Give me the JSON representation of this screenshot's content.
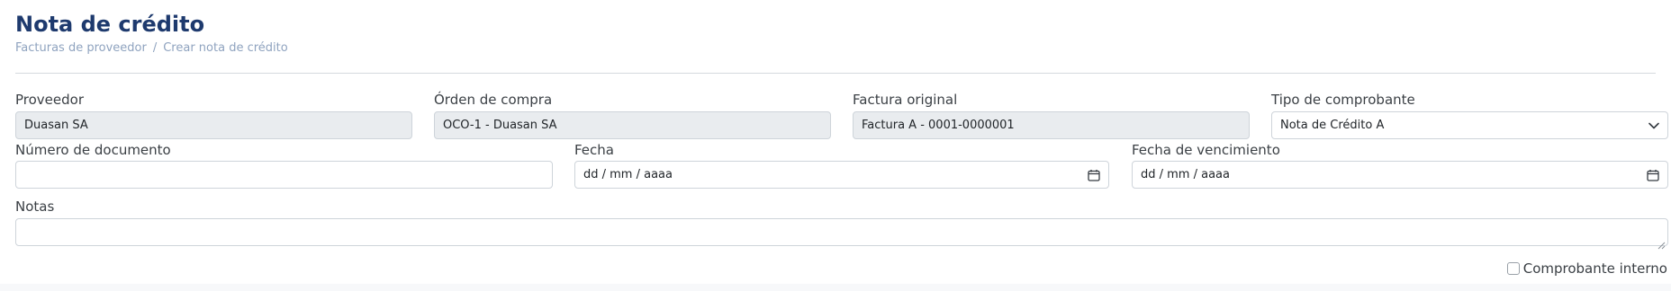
{
  "page": {
    "title": "Nota de crédito",
    "breadcrumb": [
      "Facturas de proveedor",
      "Crear nota de crédito"
    ],
    "breadcrumb_separator": "/"
  },
  "form": {
    "proveedor": {
      "label": "Proveedor",
      "value": "Duasan SA"
    },
    "orden_compra": {
      "label": "Órden de compra",
      "value": "OCO-1 - Duasan SA"
    },
    "factura_original": {
      "label": "Factura original",
      "value": "Factura A - 0001-0000001"
    },
    "tipo_comprobante": {
      "label": "Tipo de comprobante",
      "value": "Nota de Crédito A",
      "icon": "chevron-down-icon"
    },
    "numero_documento": {
      "label": "Número de documento",
      "value": ""
    },
    "fecha": {
      "label": "Fecha",
      "placeholder": "dd / mm / aaaa",
      "icon": "calendar-icon"
    },
    "fecha_vencimiento": {
      "label": "Fecha de vencimiento",
      "placeholder": "dd / mm / aaaa",
      "icon": "calendar-icon"
    },
    "notas": {
      "label": "Notas",
      "value": ""
    },
    "comprobante_interno": {
      "label": "Comprobante interno",
      "checked": false
    }
  },
  "colors": {
    "title": "#1e3a6e",
    "breadcrumb": "#8fa3bf",
    "readonly_bg": "#e9ecef",
    "border": "#ced4da"
  }
}
